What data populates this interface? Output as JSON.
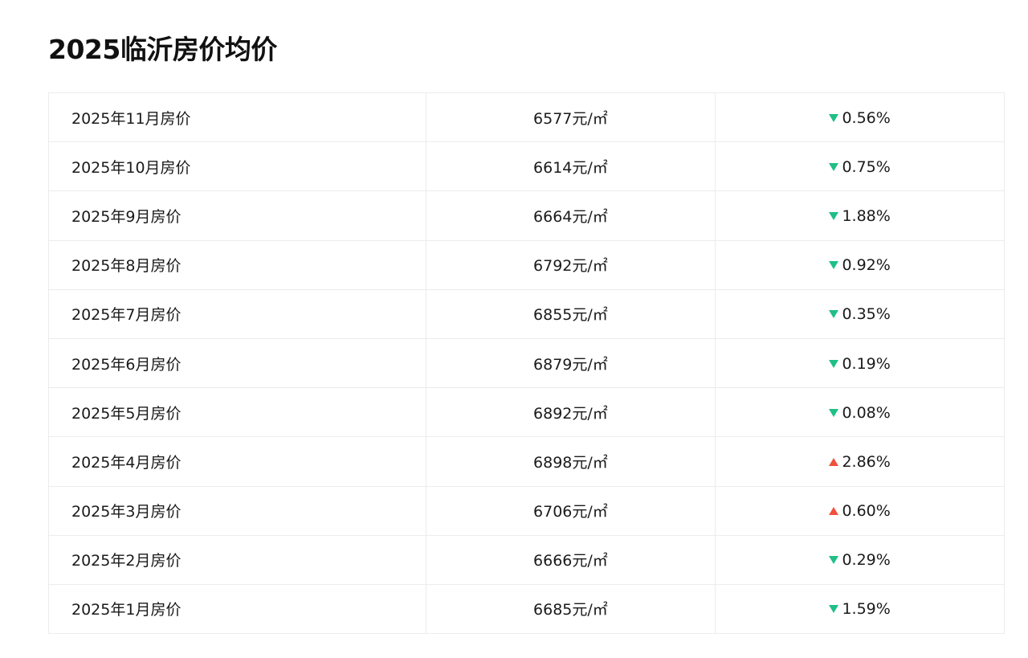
{
  "title": "2025临沂房价均价",
  "colors": {
    "down": "#1fbf86",
    "up": "#f0503c"
  },
  "rows": [
    {
      "month": "2025年11月房价",
      "price": "6577元/㎡",
      "direction": "down",
      "change": "0.56%"
    },
    {
      "month": "2025年10月房价",
      "price": "6614元/㎡",
      "direction": "down",
      "change": "0.75%"
    },
    {
      "month": "2025年9月房价",
      "price": "6664元/㎡",
      "direction": "down",
      "change": "1.88%"
    },
    {
      "month": "2025年8月房价",
      "price": "6792元/㎡",
      "direction": "down",
      "change": "0.92%"
    },
    {
      "month": "2025年7月房价",
      "price": "6855元/㎡",
      "direction": "down",
      "change": "0.35%"
    },
    {
      "month": "2025年6月房价",
      "price": "6879元/㎡",
      "direction": "down",
      "change": "0.19%"
    },
    {
      "month": "2025年5月房价",
      "price": "6892元/㎡",
      "direction": "down",
      "change": "0.08%"
    },
    {
      "month": "2025年4月房价",
      "price": "6898元/㎡",
      "direction": "up",
      "change": "2.86%"
    },
    {
      "month": "2025年3月房价",
      "price": "6706元/㎡",
      "direction": "up",
      "change": "0.60%"
    },
    {
      "month": "2025年2月房价",
      "price": "6666元/㎡",
      "direction": "down",
      "change": "0.29%"
    },
    {
      "month": "2025年1月房价",
      "price": "6685元/㎡",
      "direction": "down",
      "change": "1.59%"
    }
  ]
}
